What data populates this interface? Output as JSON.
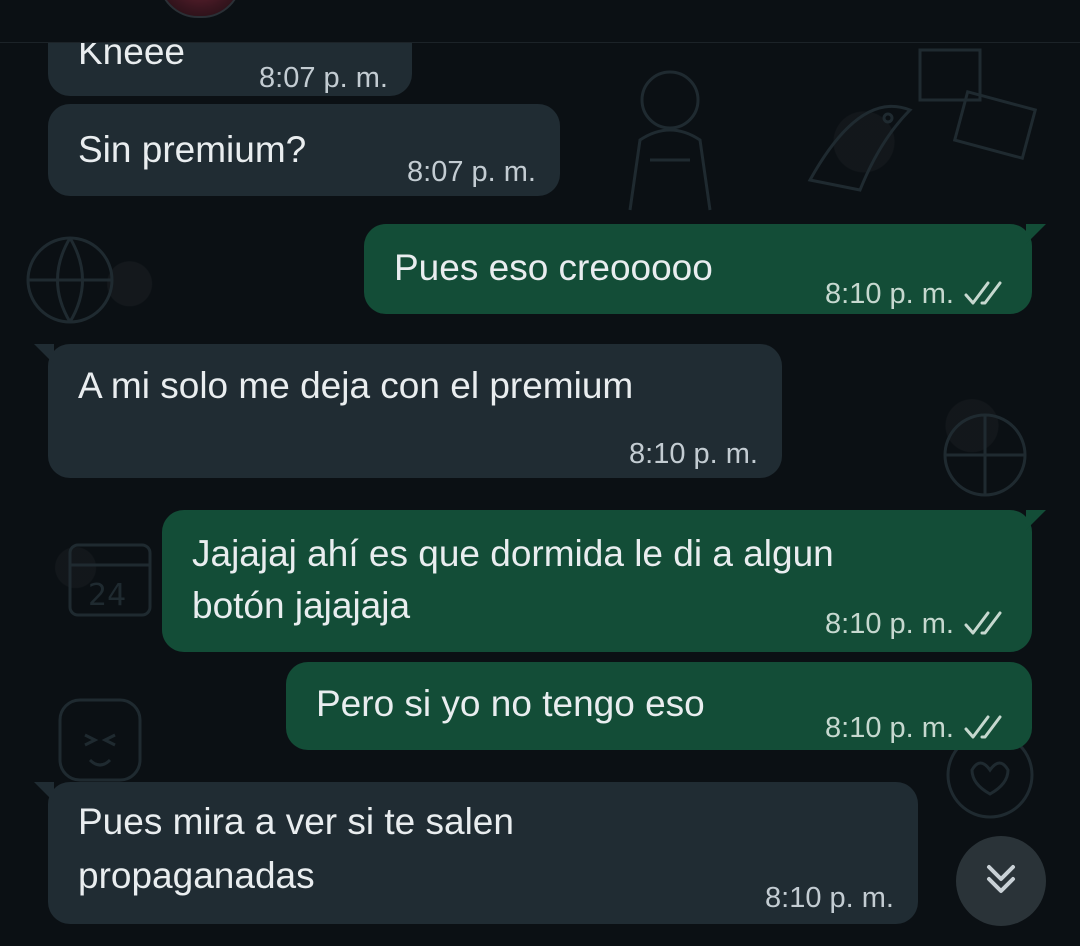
{
  "messages": [
    {
      "id": "m1",
      "direction": "incoming",
      "text": "Kneee",
      "time": "8:07 p. m."
    },
    {
      "id": "m2",
      "direction": "incoming",
      "text": "Sin premium?",
      "time": "8:07 p. m."
    },
    {
      "id": "m3",
      "direction": "outgoing",
      "text": "Pues eso creooooo",
      "time": "8:10 p. m.",
      "status": "read"
    },
    {
      "id": "m4",
      "direction": "incoming",
      "text": "A mi solo me deja con el premium",
      "time": "8:10 p. m."
    },
    {
      "id": "m5",
      "direction": "outgoing",
      "text_line1": "Jajajaj ahí es que dormida le di a algun",
      "text_line2": "botón jajajaja",
      "time": "8:10 p. m.",
      "status": "read"
    },
    {
      "id": "m6",
      "direction": "outgoing",
      "text": "Pero si yo no tengo eso",
      "time": "8:10 p. m.",
      "status": "read"
    },
    {
      "id": "m7",
      "direction": "incoming",
      "text_line1": "Pues mira a ver si te salen",
      "text_line2": "propaganadas",
      "time": "8:10 p. m."
    }
  ],
  "icons": {
    "read_receipt": "double-check-icon",
    "scroll_down": "chevron-double-down-icon"
  },
  "colors": {
    "background": "#0b1014",
    "incoming_bubble": "#202c33",
    "outgoing_bubble": "#134d37",
    "read_tick": "#c6d8cf"
  }
}
